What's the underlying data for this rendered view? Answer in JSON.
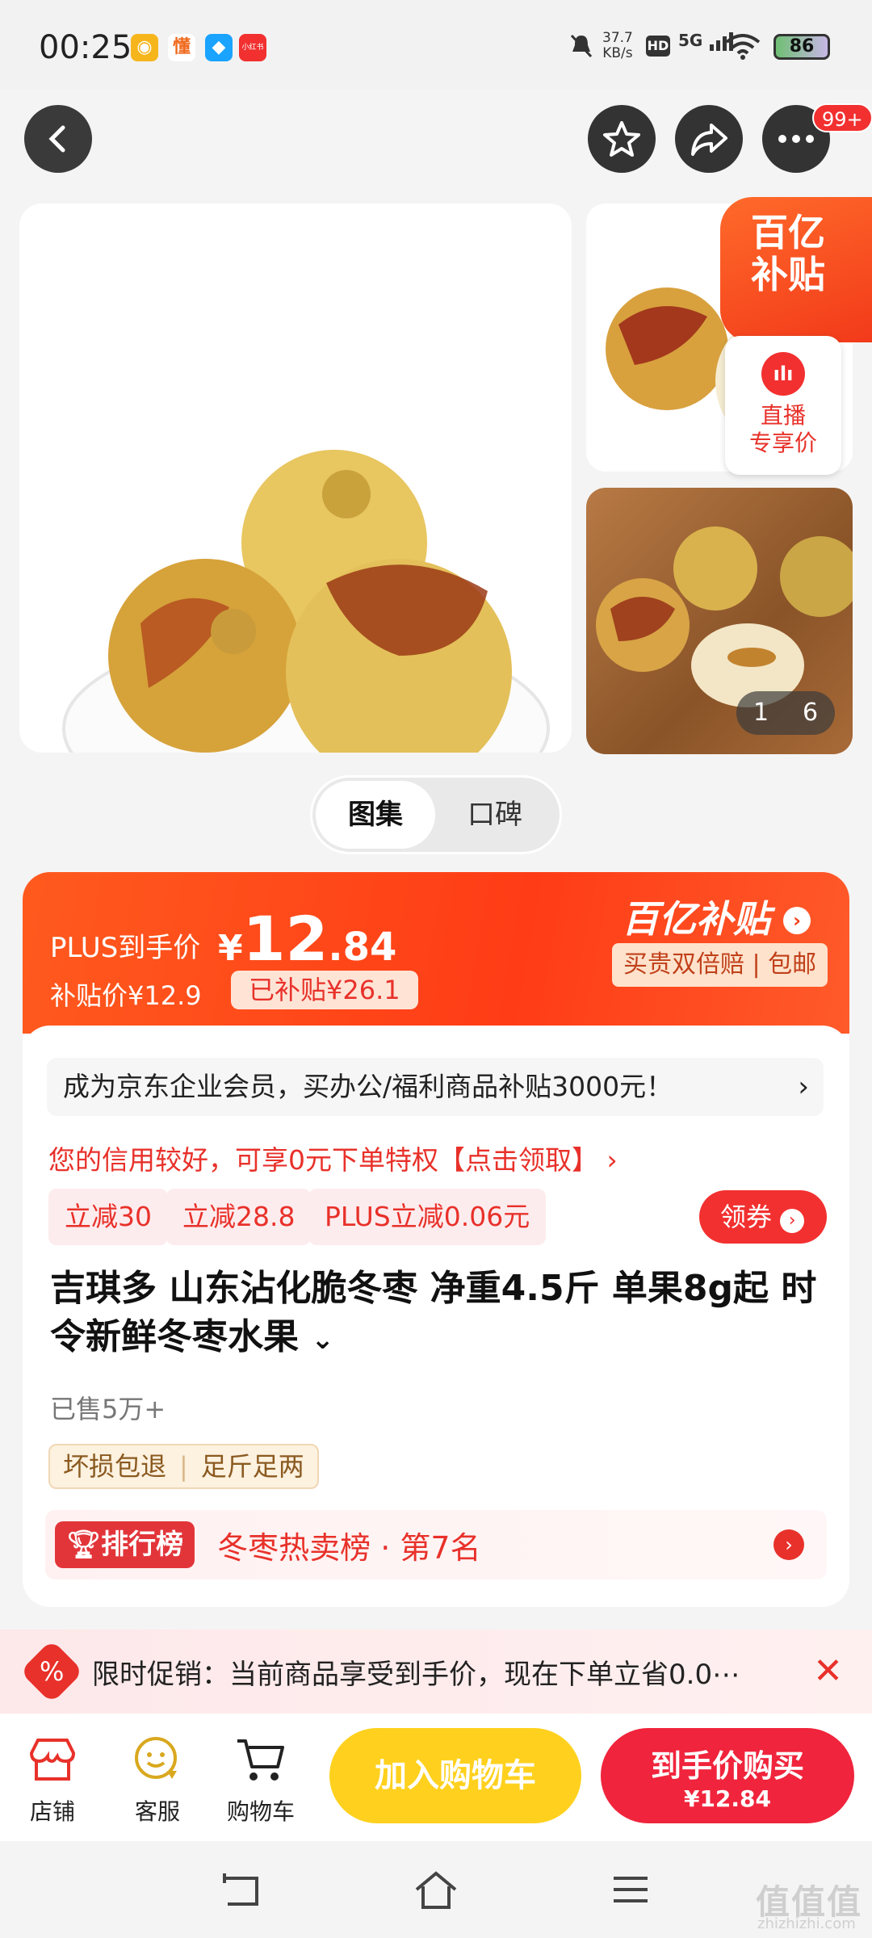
{
  "status": {
    "time": "00:25",
    "app_icons": [
      "懂",
      "小红书"
    ],
    "speed": "37.7",
    "speed_unit": "KB/s",
    "hd": "HD",
    "network": "5G",
    "battery": "86"
  },
  "top_nav": {
    "badge": "99+"
  },
  "gallery": {
    "subsidy_tag": "百亿补贴",
    "live_label_1": "直播",
    "live_label_2": "专享价",
    "pager_current": "1",
    "pager_total": "6"
  },
  "tabs": {
    "album": "图集",
    "reviews": "口碑"
  },
  "price": {
    "plus_label": "PLUS到手价",
    "currency": "¥",
    "plus_int": "12",
    "plus_dec": ".84",
    "subsidy_price_label": "补贴价¥12.9",
    "subsidized_tag": "已补贴¥26.1",
    "brand": "百亿补贴",
    "brand_sub": "买贵双倍赔 | 包邮"
  },
  "body": {
    "corp_notice": "成为京东企业会员，买办公/福利商品补贴3000元！",
    "credit_notice": "您的信用较好，可享0元下单特权【点击领取】",
    "coupons": [
      "立减30",
      "立减28.8",
      "PLUS立减0.06元"
    ],
    "get_coupon": "领券",
    "title": "吉琪多 山东沾化脆冬枣 净重4.5斤 单果8g起 时令新鲜冬枣水果",
    "sold": "已售5万+",
    "guarantees": [
      "坏损包退",
      "足斤足两"
    ],
    "rank_badge": "排行榜",
    "rank_text": "冬枣热卖榜 · 第7名"
  },
  "promo": {
    "text": "限时促销：当前商品享受到手价，现在下单立省0.0⋯"
  },
  "bottom_bar": {
    "shop": "店铺",
    "service": "客服",
    "cart": "购物车",
    "add_cart": "加入购物车",
    "buy": "到手价购买",
    "buy_price": "¥12.84"
  },
  "watermark": {
    "logo": "值值值",
    "url": "zhizhizhi.com"
  }
}
